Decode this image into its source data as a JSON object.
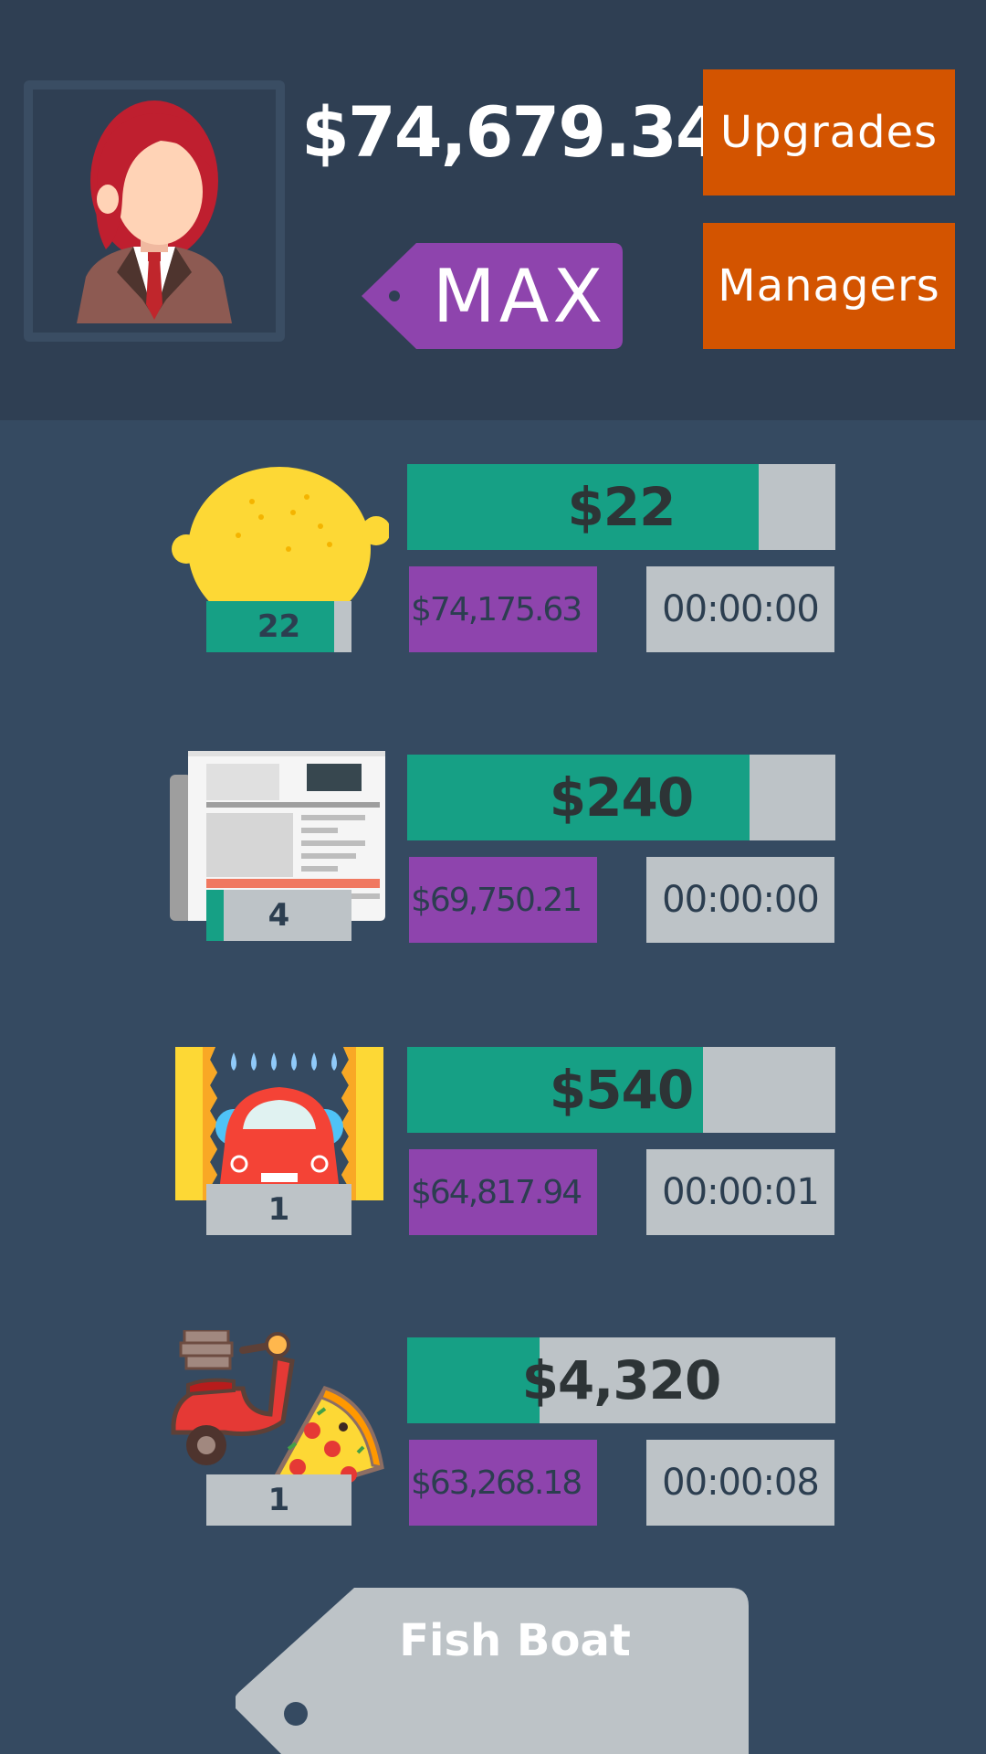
{
  "header": {
    "balance": "$74,679.34",
    "buy_multiplier": "MAX",
    "upgrades_label": "Upgrades",
    "managers_label": "Managers"
  },
  "businesses": [
    {
      "name": "lemon-stand",
      "icon": "lemon-icon",
      "owned": "22",
      "owned_progress": 0.88,
      "profit": "$22",
      "profit_progress": 0.82,
      "buy_cost": "$74,175.63",
      "timer": "00:00:00"
    },
    {
      "name": "newspaper",
      "icon": "newspaper-icon",
      "owned": "4",
      "owned_progress": 0.12,
      "profit": "$240",
      "profit_progress": 0.8,
      "buy_cost": "$69,750.21",
      "timer": "00:00:00"
    },
    {
      "name": "car-wash",
      "icon": "car-wash-icon",
      "owned": "1",
      "owned_progress": 0,
      "profit": "$540",
      "profit_progress": 0.69,
      "buy_cost": "$64,817.94",
      "timer": "00:00:01"
    },
    {
      "name": "pizza-delivery",
      "icon": "pizza-scooter-icon",
      "owned": "1",
      "owned_progress": 0,
      "profit": "$4,320",
      "profit_progress": 0.31,
      "buy_cost": "$63,268.18",
      "timer": "00:00:08"
    }
  ],
  "next_business": {
    "label": "Fish Boat",
    "icon": "price-tag-icon"
  },
  "colors": {
    "background": "#354a61",
    "header": "#2f3f53",
    "orange": "#d35400",
    "purple": "#8e44ad",
    "green": "#16a085",
    "gray": "#bdc3c7"
  }
}
